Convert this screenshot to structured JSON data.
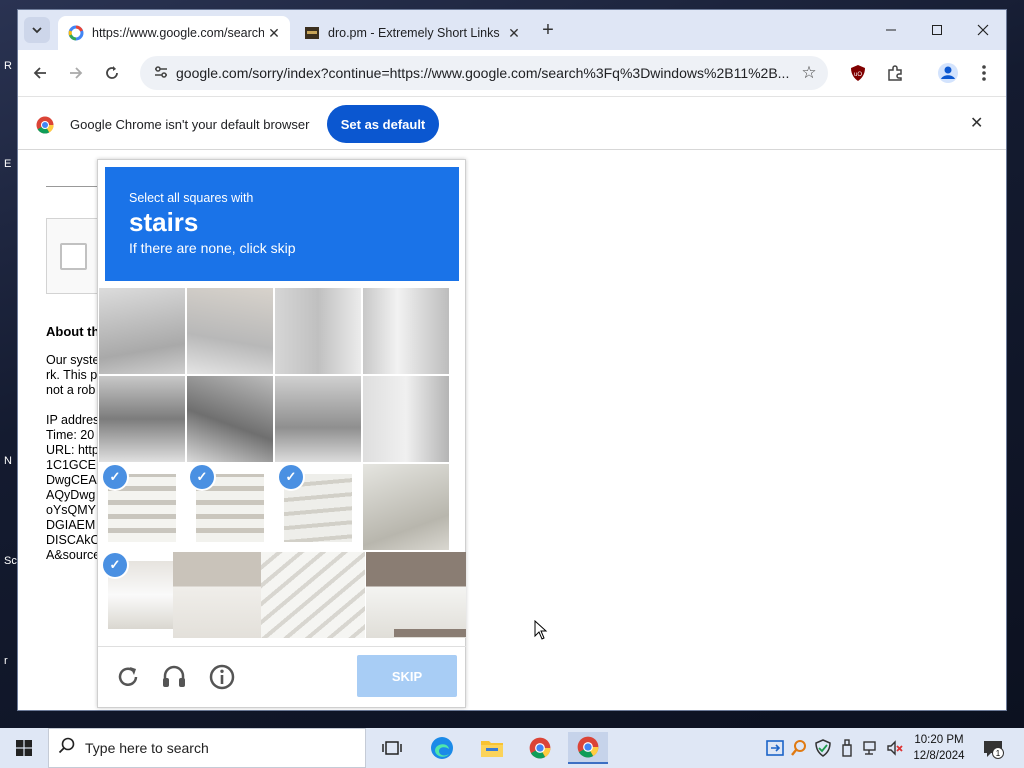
{
  "desktop": {
    "labels": [
      "R",
      "E",
      "N",
      "Sc",
      "r"
    ]
  },
  "browser": {
    "tabs": [
      {
        "title": "https://www.google.com/search",
        "active": true
      },
      {
        "title": "dro.pm - Extremely Short Links",
        "active": false
      }
    ],
    "url": "google.com/sorry/index?continue=https://www.google.com/search%3Fq%3Dwindows%2B11%2B...",
    "infobar": {
      "message": "Google Chrome isn't your default browser",
      "button": "Set as default"
    }
  },
  "page": {
    "about_heading": "About th",
    "lines": [
      "Our syste",
      "rk. This p",
      "not a rob",
      "",
      "IP addres",
      "Time: 20",
      "URL: http",
      "1C1GCE",
      "DwgCEA",
      "AQyDwg",
      "oYsQMY",
      "DGIAEM",
      "DISCAkC",
      "A&source"
    ]
  },
  "captcha": {
    "instruction_top": "Select all squares with",
    "target": "stairs",
    "instruction_bottom": "If there are none, click skip",
    "skip_label": "SKIP",
    "selected_tiles": [
      8,
      9,
      10,
      12
    ]
  },
  "taskbar": {
    "search_placeholder": "Type here to search",
    "time": "10:20 PM",
    "date": "12/8/2024",
    "notification_count": "1"
  },
  "colors": {
    "captcha_blue": "#1a73e8",
    "chrome_blue": "#0b57d0",
    "skip_disabled": "#a8cdf5"
  }
}
